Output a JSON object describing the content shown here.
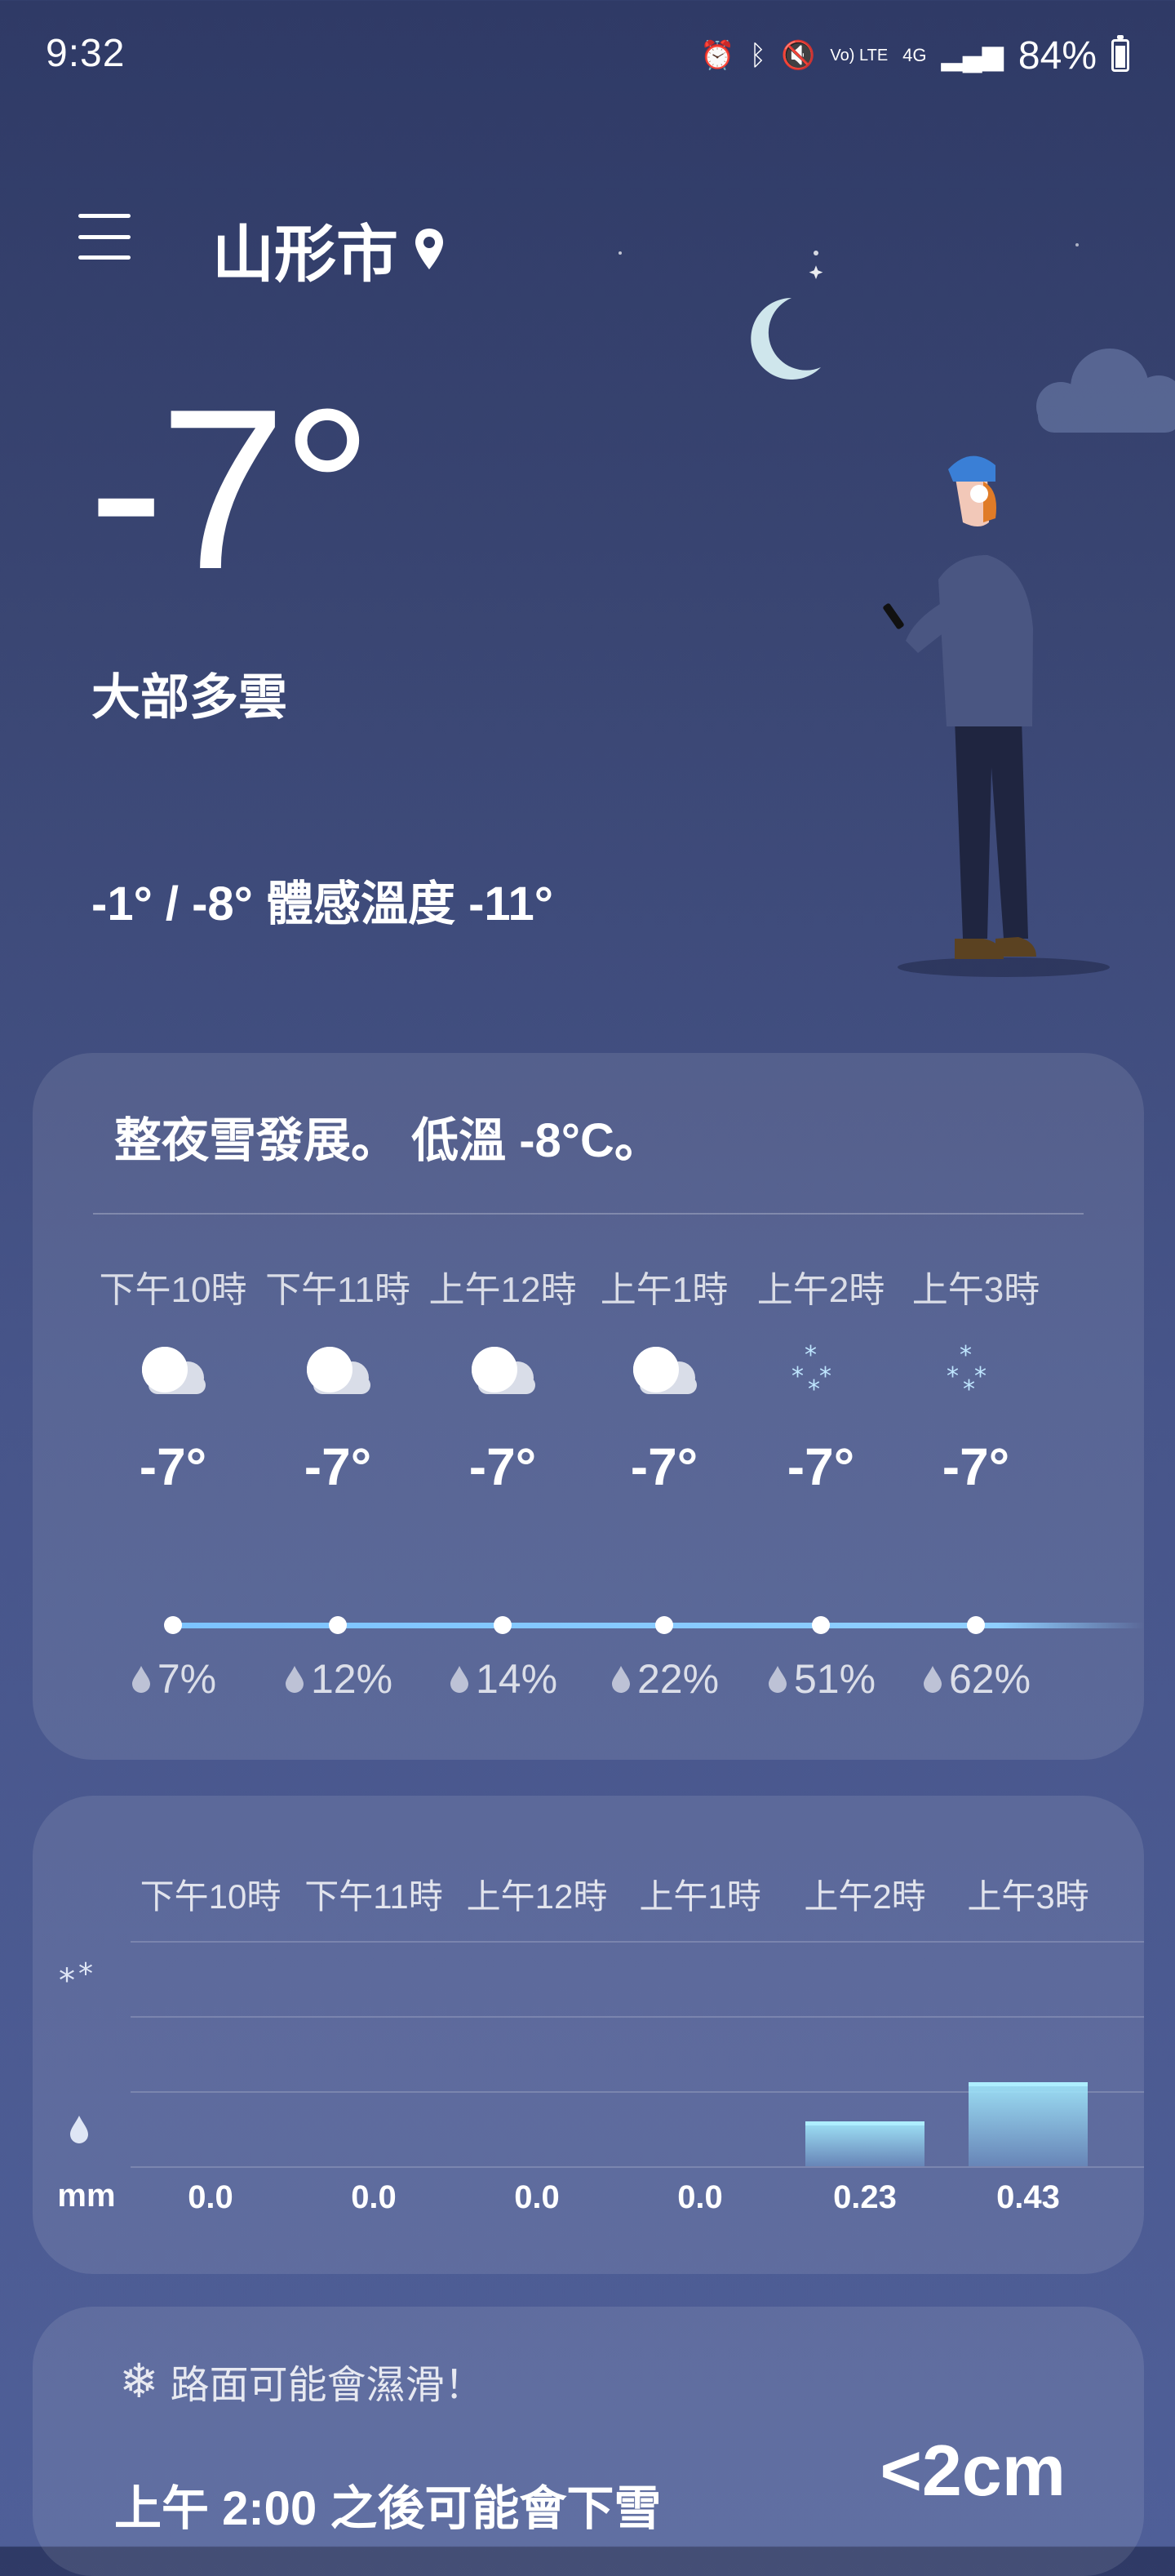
{
  "status_bar": {
    "time": "9:32",
    "battery": "84%",
    "network": "4G",
    "volte": "Vo) LTE"
  },
  "header": {
    "city": "山形市"
  },
  "current": {
    "temp": "-7°",
    "condition": "大部多雲",
    "range": "-1° / -8° 體感溫度 -11°"
  },
  "hourly_card": {
    "summary": "整夜雪發展。 低溫 -8°C。",
    "hours": [
      {
        "label": "下午10時",
        "icon": "cloud-icon",
        "temp": "-7°",
        "precip": "7%"
      },
      {
        "label": "下午11時",
        "icon": "cloud-icon",
        "temp": "-7°",
        "precip": "12%"
      },
      {
        "label": "上午12時",
        "icon": "cloud-icon",
        "temp": "-7°",
        "precip": "14%"
      },
      {
        "label": "上午1時",
        "icon": "cloud-icon",
        "temp": "-7°",
        "precip": "22%"
      },
      {
        "label": "上午2時",
        "icon": "snow-icon",
        "temp": "-7°",
        "precip": "51%"
      },
      {
        "label": "上午3時",
        "icon": "snow-icon",
        "temp": "-7°",
        "precip": "62%"
      }
    ]
  },
  "precip_card": {
    "unit": "mm",
    "hours": [
      {
        "label": "下午10時",
        "amount": "0.0"
      },
      {
        "label": "下午11時",
        "amount": "0.0"
      },
      {
        "label": "上午12時",
        "amount": "0.0"
      },
      {
        "label": "上午1時",
        "amount": "0.0"
      },
      {
        "label": "上午2時",
        "amount": "0.23"
      },
      {
        "label": "上午3時",
        "amount": "0.43"
      }
    ]
  },
  "snow_card": {
    "warning": "路面可能會濕滑！",
    "forecast": "上午 2:00 之後可能會下雪",
    "depth": "<2cm"
  },
  "colors": {
    "accent_line": "#7cc3ff",
    "bar": "#aeeeff"
  }
}
